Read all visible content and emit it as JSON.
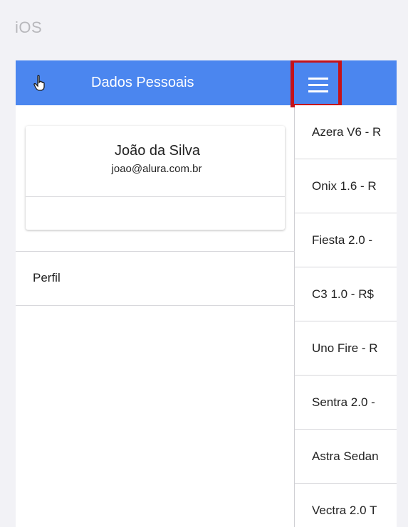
{
  "platform_label": "iOS",
  "menu": {
    "title": "Dados Pessoais",
    "user": {
      "name": "João da Silva",
      "email": "joao@alura.com.br"
    },
    "items": [
      {
        "label": "Perfil"
      }
    ]
  },
  "list": {
    "items": [
      "Azera V6 - R",
      "Onix 1.6 - R",
      "Fiesta 2.0 -",
      "C3 1.0 - R$",
      "Uno Fire - R",
      "Sentra 2.0 -",
      "Astra Sedan",
      "Vectra 2.0 T"
    ]
  },
  "colors": {
    "header": "#4b86ef",
    "highlight_box": "#c4121a"
  }
}
